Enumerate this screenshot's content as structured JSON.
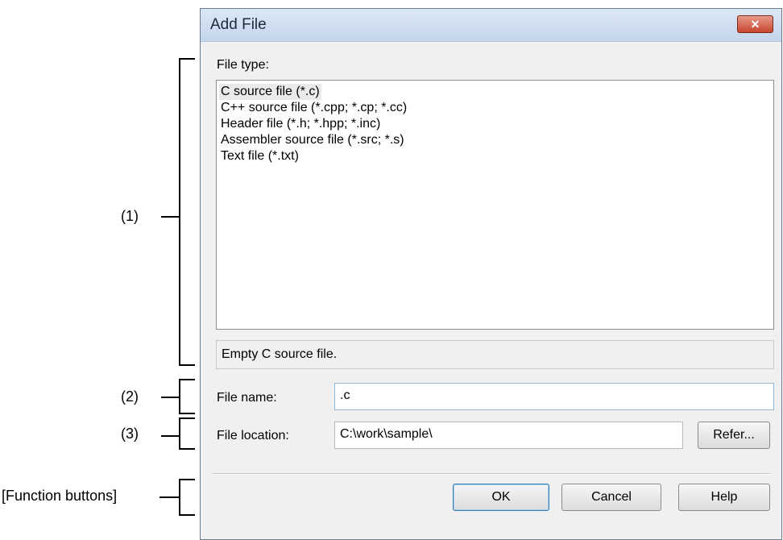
{
  "dialog": {
    "title": "Add File",
    "close_icon": "close-icon",
    "file_type_label": "File type:",
    "file_types": [
      "C source file (*.c)",
      "C++ source file (*.cpp; *.cp; *.cc)",
      "Header file (*.h; *.hpp; *.inc)",
      "Assembler source file (*.src; *.s)",
      "Text file (*.txt)"
    ],
    "description": "Empty C source file.",
    "file_name_label": "File name:",
    "file_name_value": ".c",
    "file_location_label": "File location:",
    "file_location_value": "C:\\work\\sample\\",
    "refer_button": "Refer...",
    "ok_button": "OK",
    "cancel_button": "Cancel",
    "help_button": "Help"
  },
  "annotations": {
    "area1": "(1)",
    "area2": "(2)",
    "area3": "(3)",
    "function_buttons": "[Function buttons]"
  },
  "colors": {
    "titlebar": "#c4d6ec",
    "close_button": "#c7452f",
    "dialog_bg": "#f0f0f0"
  }
}
